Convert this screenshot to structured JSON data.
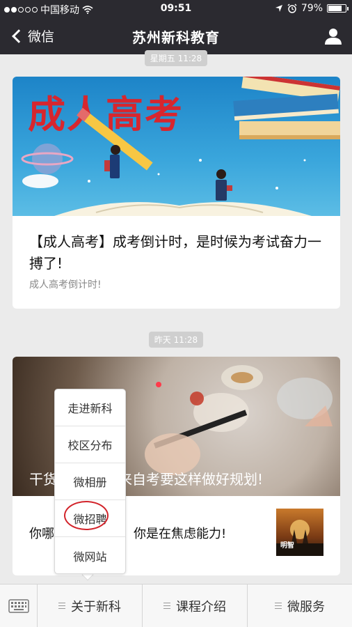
{
  "status_bar": {
    "carrier": "中国移动",
    "time": "09:51",
    "battery": "79%",
    "battery_level": 0.79
  },
  "nav": {
    "back_label": "微信",
    "title": "苏州新科教育"
  },
  "messages": [
    {
      "timestamp": "星期五 11:28",
      "banner_text": "成人高考",
      "title": "【成人高考】成考倒计时，是时候为考试奋力一搏了!",
      "desc": "成人高考倒计时!"
    },
    {
      "timestamp": "昨天 11:28",
      "caption_left": "干货",
      "caption_right": "来自考要这样做好规划!",
      "text_left": "你哪",
      "text_right": "纪，你是在焦虑能力!",
      "thumb_label": "明智"
    }
  ],
  "popup_menu": {
    "items": [
      "走进新科",
      "校区分布",
      "微相册",
      "微招聘",
      "微网站"
    ],
    "highlighted": "微招聘"
  },
  "bottom_menu": {
    "items": [
      "关于新科",
      "课程介绍",
      "微服务"
    ]
  },
  "colors": {
    "nav_bg": "#2b2a30",
    "highlight_circle": "#d2232a",
    "banner_text": "#d7262e"
  }
}
